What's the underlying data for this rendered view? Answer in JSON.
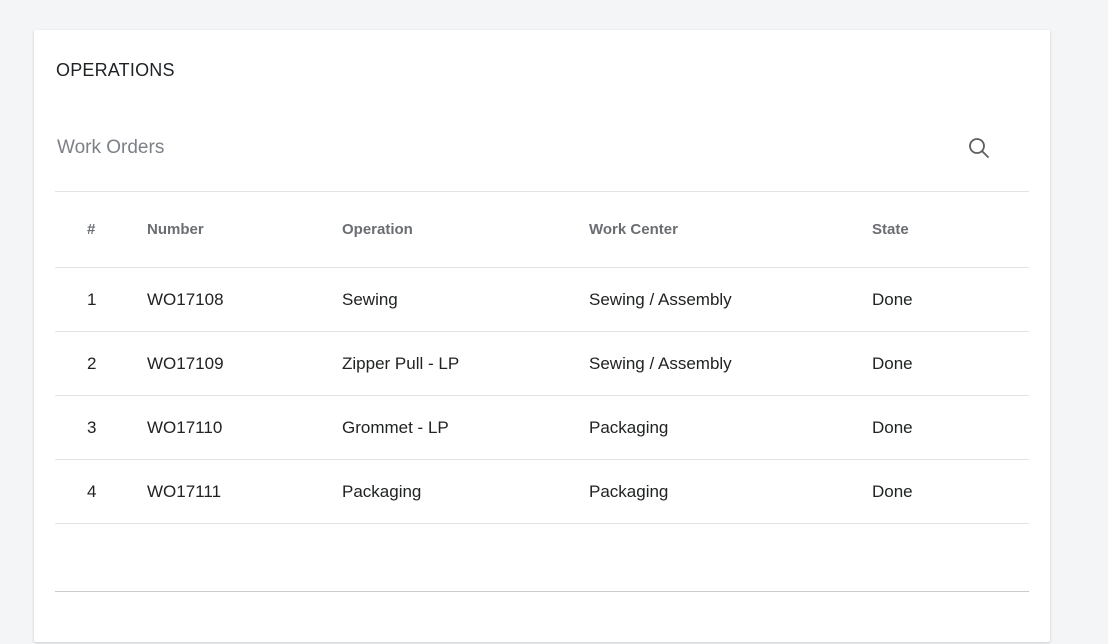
{
  "card": {
    "title": "OPERATIONS"
  },
  "search": {
    "placeholder": "Work Orders",
    "value": ""
  },
  "table": {
    "headers": [
      "#",
      "Number",
      "Operation",
      "Work Center",
      "State"
    ],
    "rows": [
      {
        "index": "1",
        "number": "WO17108",
        "operation": "Sewing",
        "work_center": "Sewing / Assembly",
        "state": "Done"
      },
      {
        "index": "2",
        "number": "WO17109",
        "operation": "Zipper Pull - LP",
        "work_center": "Sewing / Assembly",
        "state": "Done"
      },
      {
        "index": "3",
        "number": "WO17110",
        "operation": "Grommet - LP",
        "work_center": "Packaging",
        "state": "Done"
      },
      {
        "index": "4",
        "number": "WO17111",
        "operation": "Packaging",
        "work_center": "Packaging",
        "state": "Done"
      }
    ]
  },
  "icons": {
    "search": "search-icon"
  }
}
